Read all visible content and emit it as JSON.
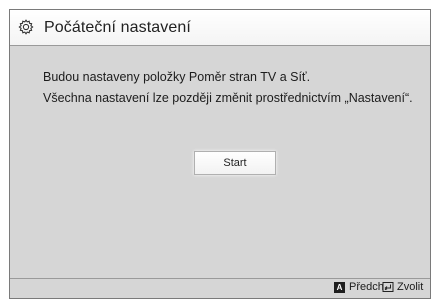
{
  "dialog": {
    "title": "Počáteční nastavení",
    "message_line1": "Budou nastaveny položky Poměr stran TV a Síť.",
    "message_line2": "Všechna nastavení lze později změnit prostřednictvím „Nastavení“.",
    "start_label": "Start"
  },
  "footer": {
    "prev_key": "A",
    "prev_label": "Předch.",
    "select_label": "Zvolit"
  },
  "icons": {
    "title": "gear-icon",
    "prev": "a-key-icon",
    "select": "enter-icon"
  }
}
